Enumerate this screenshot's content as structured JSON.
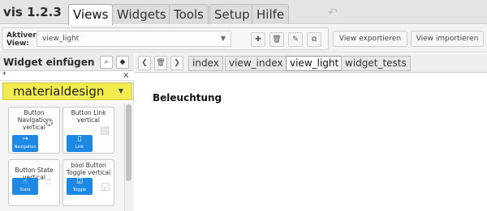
{
  "app": {
    "title": "vis 1.2.3"
  },
  "menu": {
    "tabs": [
      {
        "label": "Views"
      },
      {
        "label": "Widgets"
      },
      {
        "label": "Tools"
      },
      {
        "label": "Setup"
      },
      {
        "label": "Hilfe"
      }
    ],
    "undo_icon": "undo-arrow-icon"
  },
  "toolbar": {
    "view_label": "Aktiver View:",
    "view_value": "view_light",
    "icons": [
      "plus-icon",
      "trash-icon",
      "pencil-icon",
      "copy-icon"
    ],
    "export_label": "View exportieren",
    "import_label": "View importieren"
  },
  "widget_panel": {
    "title": "Widget einfügen",
    "search_icon": "magnifier-icon",
    "tag_icon": "tag-icon",
    "filter_value": "*",
    "filter_clear": "×",
    "set_value": "materialdesign",
    "widgets": [
      {
        "title": "Button Navigation vertical",
        "button_label": "Navigation",
        "glyph": "→",
        "icon": "arrow-right-icon"
      },
      {
        "title": "Button Link vertical",
        "button_label": "Link",
        "glyph": "▯",
        "icon": "bookmark-icon"
      },
      {
        "title": "Button State vertical",
        "button_label": "State",
        "glyph": "☝",
        "icon": "touch-icon"
      },
      {
        "title": "bool Button Toggle vertical",
        "button_label": "Toggle",
        "glyph": "☑",
        "icon": "checkbox-icon"
      }
    ]
  },
  "pages": {
    "nav_icons": [
      "chevron-left-icon",
      "trash-icon",
      "chevron-right-icon"
    ],
    "tabs": [
      {
        "label": "index"
      },
      {
        "label": "view_index"
      },
      {
        "label": "view_light",
        "active": true
      },
      {
        "label": "widget_tests"
      }
    ]
  },
  "canvas": {
    "heading": "Beleuchtung"
  },
  "colors": {
    "accent": "#1e88e5",
    "set_highlight": "#f2ec4f"
  }
}
